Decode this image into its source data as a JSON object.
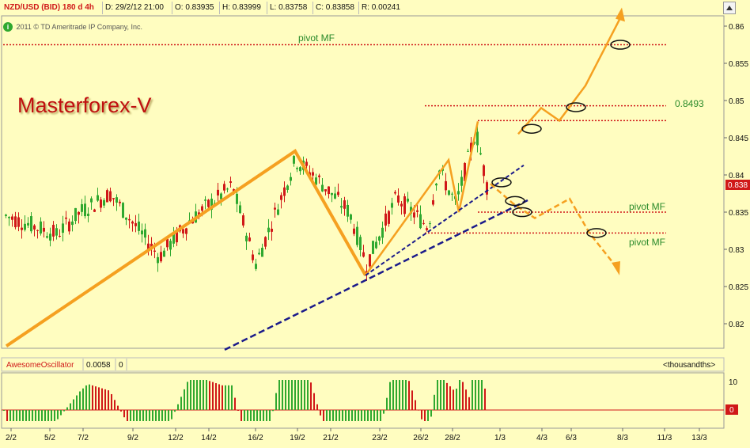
{
  "header": {
    "symbol": "NZD/USD (BID) 180 d 4h",
    "date": "D: 29/2/12 21:00",
    "open": "O: 0.83935",
    "high": "H: 0.83999",
    "low": "L: 0.83758",
    "close": "C: 0.83858",
    "range": "R: 0.00241"
  },
  "copyright": "2011 © TD Ameritrade IP Company, Inc.",
  "watermark": "Masterforex-V",
  "annotations": {
    "pivot_top": "pivot MF",
    "level_label": "0.8493",
    "pivot_mid": "pivot MF",
    "pivot_low": "pivot MF"
  },
  "price_tag": "0.838",
  "oscillator": {
    "name": "AwesomeOscillator",
    "value": "0.0058",
    "zero": "0",
    "units": "<thousandths>",
    "axis_max": "10",
    "zero_tag": "0"
  },
  "colors": {
    "background": "#fffdc0",
    "bull_candle": "#2fa82f",
    "bear_candle": "#d01818",
    "trend_orange": "#f5a020",
    "trend_blue": "#1a1a8a",
    "pivot_red": "#d01818",
    "watermark_red": "#c01010"
  },
  "chart_data": {
    "type": "candlestick",
    "y_ticks": [
      "0.86",
      "0.855",
      "0.85",
      "0.845",
      "0.84",
      "0.835",
      "0.83",
      "0.825",
      "0.82"
    ],
    "ylim": [
      0.8165,
      0.8615
    ],
    "x_ticks": [
      "2/2",
      "5/2",
      "7/2",
      "9/2",
      "12/2",
      "14/2",
      "16/2",
      "19/2",
      "21/2",
      "23/2",
      "26/2",
      "28/2",
      "1/3",
      "4/3",
      "6/3",
      "8/3",
      "11/3",
      "13/3"
    ],
    "pivot_levels": [
      0.8575,
      0.8493,
      0.8473,
      0.835,
      0.8322
    ],
    "last_price": 0.838,
    "zigzag_path": [
      [
        "2/2",
        0.817
      ],
      [
        "19/2",
        0.8432
      ],
      [
        "23/2",
        0.8265
      ],
      [
        "28/2",
        0.842
      ],
      [
        "28/2",
        0.835
      ],
      [
        "29/2",
        0.8472
      ]
    ],
    "price_path": [
      [
        "23/2",
        0.8265
      ],
      [
        "27/2",
        0.842
      ],
      [
        "28/2",
        0.835
      ],
      [
        "29/2",
        0.847
      ]
    ],
    "trend_lines": [
      {
        "from": [
          "15/2",
          0.8165
        ],
        "to": [
          "1/3",
          0.8365
        ]
      },
      {
        "from": [
          "23/2",
          0.8265
        ],
        "to": [
          "2/3",
          0.8412
        ]
      }
    ],
    "projection_up": [
      [
        0.8455
      ],
      [
        0.849
      ],
      [
        0.8473
      ],
      [
        0.8575
      ],
      [
        0.8625
      ]
    ],
    "projection_down": [
      [
        0.8388
      ],
      [
        0.8362
      ],
      [
        0.8342
      ],
      [
        0.8368
      ],
      [
        0.8322
      ],
      [
        0.8275
      ]
    ]
  }
}
